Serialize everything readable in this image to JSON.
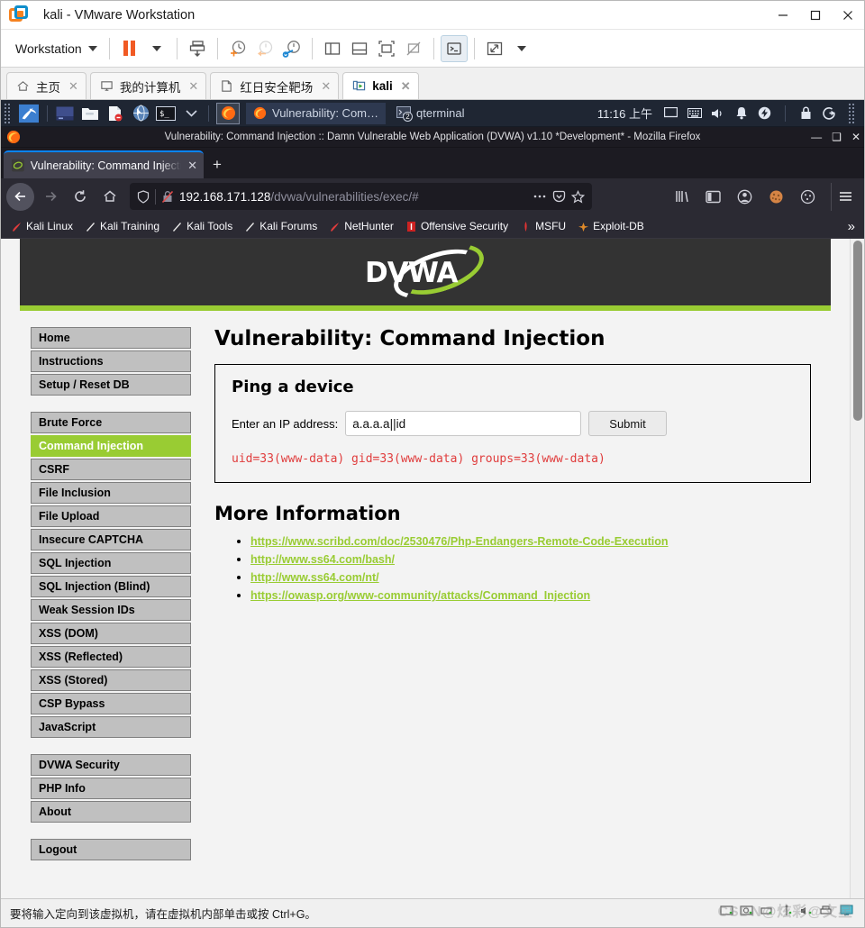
{
  "vmware": {
    "window_title": "kali - VMware Workstation",
    "logo_icon": "vmware-logo-icon",
    "window_controls": [
      {
        "name": "minimize-button",
        "glyph": "—"
      },
      {
        "name": "maximize-button",
        "glyph": "□"
      },
      {
        "name": "close-button",
        "glyph": "✕"
      }
    ],
    "toolbar": {
      "workstation_menu_label": "Workstation",
      "buttons": [
        {
          "name": "pause-vm-button",
          "icon": "pause-icon"
        },
        {
          "name": "pause-dropdown-button",
          "icon": "chevron-down-icon"
        },
        {
          "name": "manage-snapshot-button",
          "icon": "snapshot-manage-icon"
        },
        {
          "name": "take-snapshot-button",
          "icon": "snapshot-add-icon"
        },
        {
          "name": "revert-snapshot-button",
          "icon": "snapshot-revert-icon"
        },
        {
          "name": "snapshot-manager-button",
          "icon": "snapshot-settings-icon"
        },
        {
          "name": "show-left-pane-button",
          "icon": "panel-left-icon"
        },
        {
          "name": "show-bottom-pane-button",
          "icon": "panel-bottom-icon"
        },
        {
          "name": "fit-guest-button",
          "icon": "fit-guest-icon"
        },
        {
          "name": "fit-window-button",
          "icon": "fit-window-off-icon"
        },
        {
          "name": "console-view-button",
          "icon": "console-icon"
        },
        {
          "name": "fullscreen-button",
          "icon": "fullscreen-icon"
        },
        {
          "name": "fullscreen-dropdown-button",
          "icon": "chevron-down-icon"
        }
      ]
    },
    "tabs": [
      {
        "label": "主页",
        "icon": "home-icon",
        "active": false
      },
      {
        "label": "我的计算机",
        "icon": "monitor-icon",
        "active": false
      },
      {
        "label": "红日安全靶场",
        "icon": "folder-icon",
        "active": false
      },
      {
        "label": "kali",
        "icon": "vm-running-icon",
        "active": true
      }
    ],
    "tab_close_glyph": "✕",
    "statusbar": {
      "message": "要将输入定向到该虚拟机，请在虚拟机内部单击或按 Ctrl+G。",
      "device_icons": [
        "hdd-icon",
        "cd-icon",
        "network-icon",
        "usb-icon",
        "sound-icon",
        "printer-icon",
        "display-icon"
      ],
      "watermark": "CSDN@炫彩@文星"
    }
  },
  "kali_taskbar": {
    "menu_icon": "kali-dragon-icon",
    "launchers": [
      {
        "name": "launcher-terminal-emulator",
        "icon": "terminal-window-icon"
      },
      {
        "name": "launcher-file-manager",
        "icon": "folder-icon"
      },
      {
        "name": "launcher-text-editor",
        "icon": "document-icon"
      },
      {
        "name": "launcher-web-browser",
        "icon": "globe-icon"
      },
      {
        "name": "launcher-root-terminal",
        "icon": "root-terminal-icon"
      },
      {
        "name": "launcher-more",
        "icon": "chevron-down-icon"
      }
    ],
    "pinned": {
      "name": "launcher-firefox",
      "icon": "firefox-icon"
    },
    "windows": [
      {
        "label": "Vulnerability: Com…",
        "icon": "firefox-icon",
        "badge": "",
        "focused": true
      },
      {
        "label": "qterminal",
        "icon": "terminal-icon",
        "badge": "2",
        "focused": false
      }
    ],
    "clock": "11:16 上午",
    "tray_icons": [
      "display-icon",
      "keyboard-icon",
      "volume-icon",
      "bell-icon",
      "power-icon",
      "lock-icon",
      "logout-icon",
      "grip-icon"
    ]
  },
  "firefox": {
    "window_title": "Vulnerability: Command Injection :: Damn Vulnerable Web Application (DVWA) v1.10 *Development* - Mozilla Firefox",
    "window_controls": [
      {
        "name": "minimize-button",
        "glyph": "—"
      },
      {
        "name": "maximize-button",
        "glyph": "❑"
      },
      {
        "name": "close-button",
        "glyph": "✕"
      }
    ],
    "tab": {
      "label": "Vulnerability: Command Injection",
      "favicon": "dvwa-favicon",
      "close_glyph": "✕"
    },
    "new_tab_glyph": "+",
    "nav": {
      "back": "back-arrow-icon",
      "forward": "forward-arrow-icon",
      "reload": "reload-icon",
      "home": "home-icon"
    },
    "urlbar": {
      "shield_icon": "shield-icon",
      "insecure_icon": "insecure-lock-icon",
      "host": "192.168.171.128",
      "path": "/dvwa/vulnerabilities/exec/#",
      "page_actions_icon": "ellipsis-icon",
      "pocket_icon": "pocket-icon",
      "bookmark_icon": "star-icon"
    },
    "toolbar_icons": [
      {
        "name": "library-button",
        "icon": "library-icon"
      },
      {
        "name": "sidebar-button",
        "icon": "sidebar-icon"
      },
      {
        "name": "account-button",
        "icon": "account-icon"
      },
      {
        "name": "cookie-button",
        "icon": "cookie-icon"
      },
      {
        "name": "cookie-manager-button",
        "icon": "cookie-outline-icon"
      },
      {
        "name": "app-menu-button",
        "icon": "hamburger-icon"
      }
    ],
    "bookmarks": [
      {
        "label": "Kali Linux",
        "icon": "kali-icon"
      },
      {
        "label": "Kali Training",
        "icon": "kali-tool-icon"
      },
      {
        "label": "Kali Tools",
        "icon": "kali-tool-icon"
      },
      {
        "label": "Kali Forums",
        "icon": "kali-tool-icon"
      },
      {
        "label": "NetHunter",
        "icon": "nethunter-icon"
      },
      {
        "label": "Offensive Security",
        "icon": "offsec-icon"
      },
      {
        "label": "MSFU",
        "icon": "msf-icon"
      },
      {
        "label": "Exploit-DB",
        "icon": "exploitdb-icon"
      }
    ],
    "bookmarks_overflow_glyph": "»"
  },
  "dvwa": {
    "logo_text": "DVWA",
    "page_title": "Vulnerability: Command Injection",
    "sidebar_groups": [
      [
        "Home",
        "Instructions",
        "Setup / Reset DB"
      ],
      [
        "Brute Force",
        "Command Injection",
        "CSRF",
        "File Inclusion",
        "File Upload",
        "Insecure CAPTCHA",
        "SQL Injection",
        "SQL Injection (Blind)",
        "Weak Session IDs",
        "XSS (DOM)",
        "XSS (Reflected)",
        "XSS (Stored)",
        "CSP Bypass",
        "JavaScript"
      ],
      [
        "DVWA Security",
        "PHP Info",
        "About"
      ],
      [
        "Logout"
      ]
    ],
    "selected_sidebar_item": "Command Injection",
    "panel": {
      "heading": "Ping a device",
      "field_label": "Enter an IP address:",
      "input_value": "a.a.a.a||id",
      "input_placeholder": "",
      "submit_label": "Submit",
      "output": "uid=33(www-data) gid=33(www-data) groups=33(www-data)",
      "output_color": "#e03c3c"
    },
    "more_information": {
      "heading": "More Information",
      "links": [
        "https://www.scribd.com/doc/2530476/Php-Endangers-Remote-Code-Execution",
        "http://www.ss64.com/bash/",
        "http://www.ss64.com/nt/",
        "https://owasp.org/www-community/attacks/Command_Injection"
      ]
    },
    "accent_color": "#99cc33",
    "header_bg": "#333333"
  }
}
